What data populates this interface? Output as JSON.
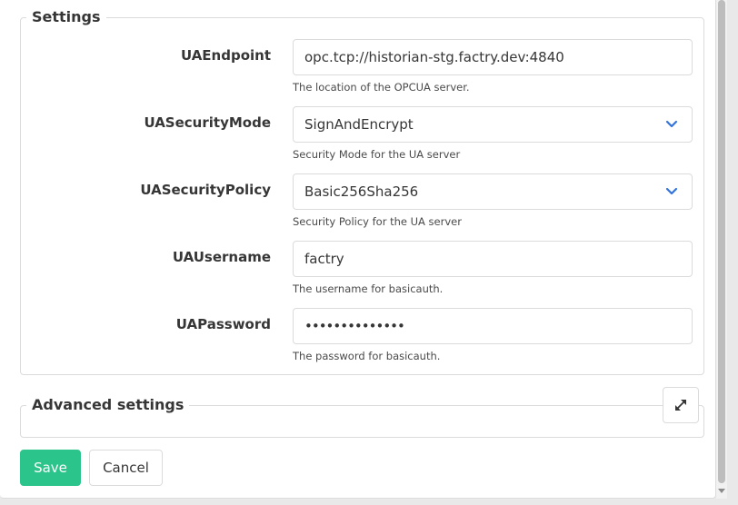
{
  "settings": {
    "legend": "Settings",
    "fields": [
      {
        "label": "UAEndpoint",
        "value": "opc.tcp://historian-stg.factry.dev:4840",
        "help": "The location of the OPCUA server."
      },
      {
        "label": "UASecurityMode",
        "value": "SignAndEncrypt",
        "help": "Security Mode for the UA server"
      },
      {
        "label": "UASecurityPolicy",
        "value": "Basic256Sha256",
        "help": "Security Policy for the UA server"
      },
      {
        "label": "UAUsername",
        "value": "factry",
        "help": "The username for basicauth."
      },
      {
        "label": "UAPassword",
        "value": "••••••••••••••",
        "help": "The password for basicauth."
      }
    ]
  },
  "advanced": {
    "legend": "Advanced settings"
  },
  "actions": {
    "save_label": "Save",
    "cancel_label": "Cancel"
  },
  "icons": {
    "select_chevron": "chevron-down-icon",
    "expand": "expand-icon"
  },
  "colors": {
    "accent": "#2bc48a",
    "chevron": "#3273dc"
  }
}
